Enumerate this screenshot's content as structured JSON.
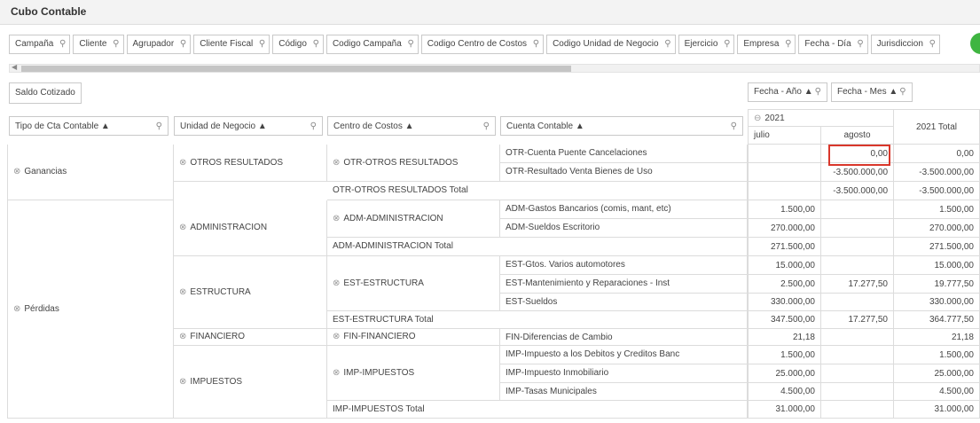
{
  "window": {
    "title": "Cubo Contable"
  },
  "filter_fields": [
    "Campaña",
    "Cliente",
    "Agrupador",
    "Cliente Fiscal",
    "Código",
    "Codigo Campaña",
    "Codigo Centro de Costos",
    "Codigo Unidad de Negocio",
    "Ejercicio",
    "Empresa",
    "Fecha - Día",
    "Jurisdiccion"
  ],
  "data_field": "Saldo Cotizado",
  "column_fields": [
    "Fecha - Año ▲",
    "Fecha - Mes ▲"
  ],
  "row_fields": [
    "Tipo de Cta Contable ▲",
    "Unidad de Negocio ▲",
    "Centro de Costos ▲",
    "Cuenta Contable ▲"
  ],
  "column_headers": {
    "year": "2021",
    "months": [
      "julio",
      "agosto"
    ],
    "total": "2021 Total"
  },
  "cells": {
    "tipo_ganancias": "Ganancias",
    "tipo_perdidas": "Pérdidas",
    "un_otros": "OTROS RESULTADOS",
    "cc_otros": "OTR-OTROS RESULTADOS",
    "cta_otr_1": "OTR-Cuenta Puente Cancelaciones",
    "cta_otr_2": "OTR-Resultado Venta Bienes de Uso",
    "tot_otr": "OTR-OTROS RESULTADOS Total",
    "un_adm": "ADMINISTRACION",
    "cc_adm": "ADM-ADMINISTRACION",
    "cta_adm_1": "ADM-Gastos Bancarios (comis, mant, etc)",
    "cta_adm_2": "ADM-Sueldos Escritorio",
    "tot_adm": "ADM-ADMINISTRACION Total",
    "un_est": "ESTRUCTURA",
    "cc_est": "EST-ESTRUCTURA",
    "cta_est_1": "EST-Gtos. Varios automotores",
    "cta_est_2": "EST-Mantenimiento y Reparaciones - Inst",
    "cta_est_3": "EST-Sueldos",
    "tot_est": "EST-ESTRUCTURA Total",
    "un_fin": "FINANCIERO",
    "cc_fin": "FIN-FINANCIERO",
    "cta_fin_1": "FIN-Diferencias de Cambio",
    "un_imp": "IMPUESTOS",
    "cc_imp": "IMP-IMPUESTOS",
    "cta_imp_1": "IMP-Impuesto a los Debitos y Creditos Banc",
    "cta_imp_2": "IMP-Impuesto Inmobiliario",
    "cta_imp_3": "IMP-Tasas Municipales",
    "tot_imp": "IMP-IMPUESTOS Total"
  },
  "values": [
    [
      "",
      "0,00",
      "0,00"
    ],
    [
      "",
      "-3.500.000,00",
      "-3.500.000,00"
    ],
    [
      "",
      "-3.500.000,00",
      "-3.500.000,00"
    ],
    [
      "1.500,00",
      "",
      "1.500,00"
    ],
    [
      "270.000,00",
      "",
      "270.000,00"
    ],
    [
      "271.500,00",
      "",
      "271.500,00"
    ],
    [
      "15.000,00",
      "",
      "15.000,00"
    ],
    [
      "2.500,00",
      "17.277,50",
      "19.777,50"
    ],
    [
      "330.000,00",
      "",
      "330.000,00"
    ],
    [
      "347.500,00",
      "17.277,50",
      "364.777,50"
    ],
    [
      "21,18",
      "",
      "21,18"
    ],
    [
      "1.500,00",
      "",
      "1.500,00"
    ],
    [
      "25.000,00",
      "",
      "25.000,00"
    ],
    [
      "4.500,00",
      "",
      "4.500,00"
    ],
    [
      "31.000,00",
      "",
      "31.000,00"
    ]
  ],
  "icons": {
    "filter": "filter-icon",
    "expand": "expand-icon",
    "sort": "sort-asc-icon"
  },
  "colors": {
    "highlight": "#d9372b",
    "accent": "#3fb541"
  }
}
